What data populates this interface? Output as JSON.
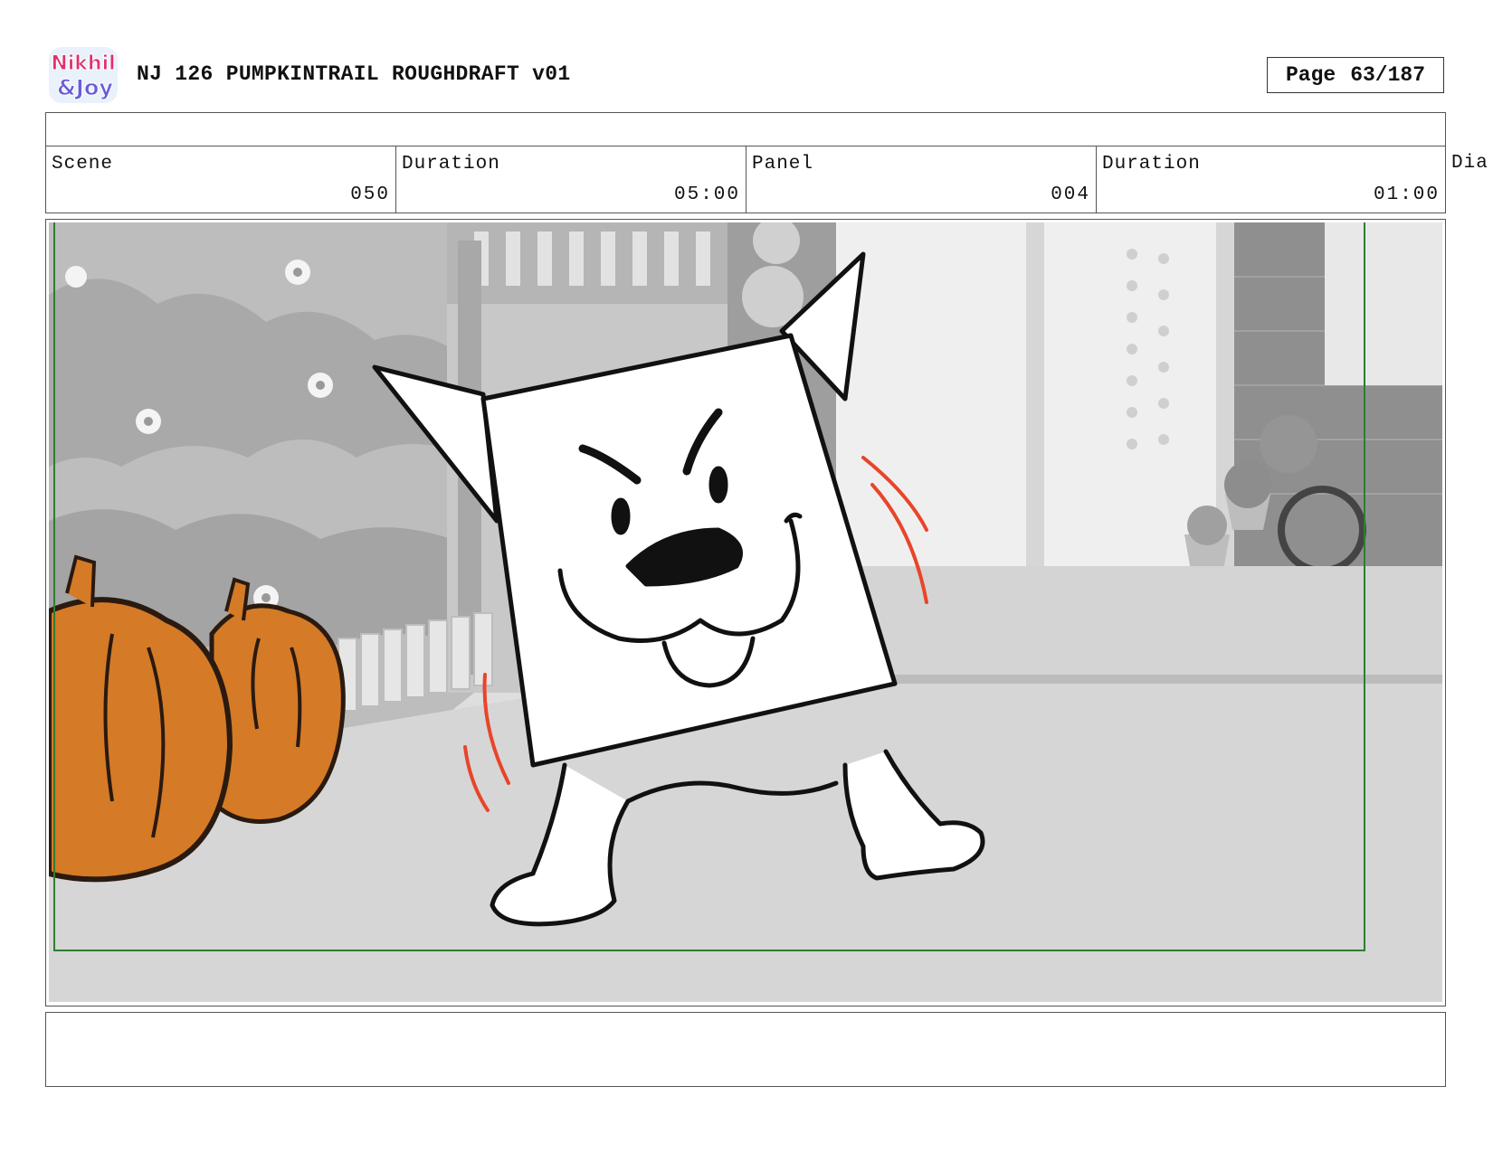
{
  "header": {
    "logo_text_line1": "Nikhil",
    "logo_text_line2": "&Joy",
    "title": "NJ 126 PUMPKINTRAIL ROUGHDRAFT v01",
    "page_label": "Page",
    "page_value": "63/187"
  },
  "info_row": {
    "scene_label": "Scene",
    "scene_value": "050",
    "scene_duration_label": "Duration",
    "scene_duration_value": "05:00",
    "panel_label": "Panel",
    "panel_value": "004",
    "panel_duration_label": "Duration",
    "panel_duration_value": "01:00",
    "dialogue_label_partial": "Dia"
  },
  "colors": {
    "pumpkin": "#d57a26",
    "motion_lines": "#e8452a",
    "safe_frame": "#2f7d32"
  }
}
